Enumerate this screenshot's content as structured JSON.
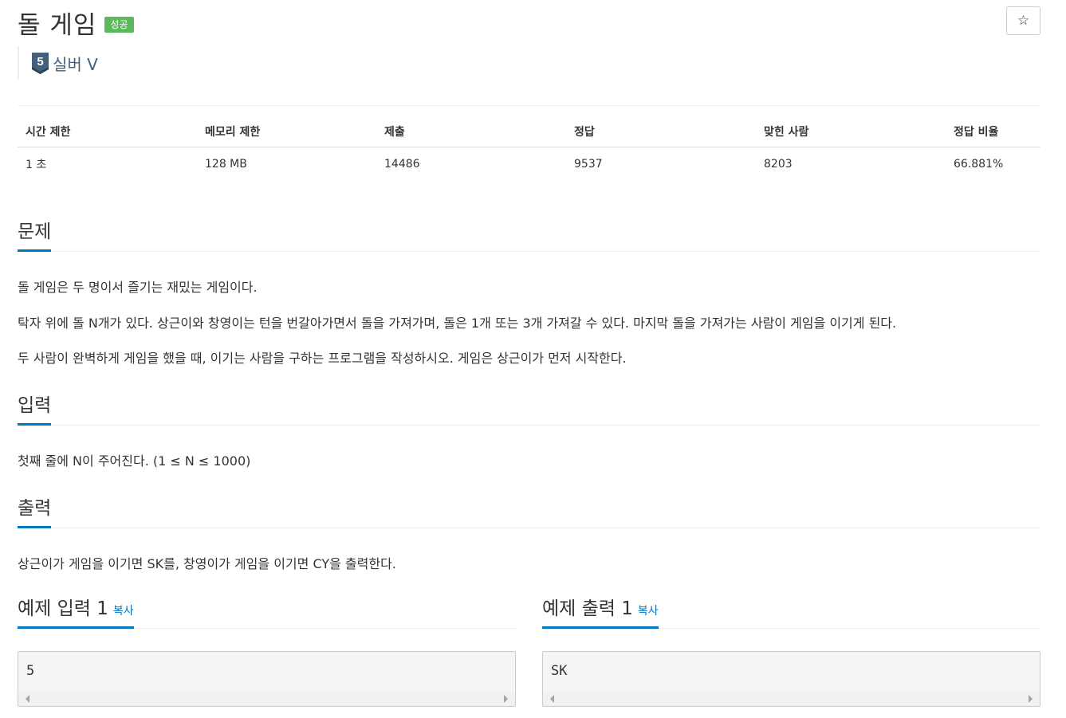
{
  "problem": {
    "title": "돌 게임",
    "status_badge": "성공",
    "star_icon": "☆",
    "tier": {
      "level": "5",
      "label": "실버 V",
      "color": "#435f7a"
    }
  },
  "info_table": {
    "headers": [
      "시간 제한",
      "메모리 제한",
      "제출",
      "정답",
      "맞힌 사람",
      "정답 비율"
    ],
    "values": [
      "1 초",
      "128 MB",
      "14486",
      "9537",
      "8203",
      "66.881%"
    ]
  },
  "sections": {
    "problem": {
      "heading": "문제",
      "paragraphs": [
        "돌 게임은 두 명이서 즐기는 재밌는 게임이다.",
        "탁자 위에 돌 N개가 있다. 상근이와 창영이는 턴을 번갈아가면서 돌을 가져가며, 돌은 1개 또는 3개 가져갈 수 있다. 마지막 돌을 가져가는 사람이 게임을 이기게 된다.",
        "두 사람이 완벽하게 게임을 했을 때, 이기는 사람을 구하는 프로그램을 작성하시오. 게임은 상근이가 먼저 시작한다."
      ]
    },
    "input": {
      "heading": "입력",
      "text": "첫째 줄에 N이 주어진다. (1 ≤ N ≤ 1000)"
    },
    "output": {
      "heading": "출력",
      "text": "상근이가 게임을 이기면 SK를, 창영이가 게임을 이기면 CY을 출력한다."
    }
  },
  "samples": {
    "input": {
      "heading": "예제 입력 1",
      "copy_label": "복사",
      "content": "5"
    },
    "output": {
      "heading": "예제 출력 1",
      "copy_label": "복사",
      "content": "SK"
    }
  },
  "colors": {
    "accent": "#0076c0",
    "success": "#5cb85c"
  }
}
